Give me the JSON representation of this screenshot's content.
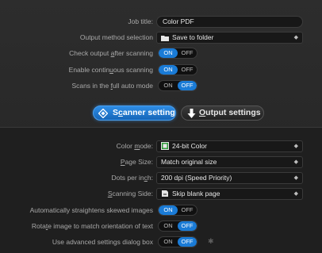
{
  "top": {
    "job_title": {
      "label": "Job title:",
      "value": "Color PDF"
    },
    "output_method": {
      "label": "Output method selection",
      "value": "Save to folder"
    },
    "check_output": {
      "label": "Check output after scanning",
      "on": "ON",
      "off": "OFF",
      "state": "on"
    },
    "continuous": {
      "label": "Enable continuous scanning",
      "on": "ON",
      "off": "OFF",
      "state": "on"
    },
    "full_auto": {
      "label": "Scans in the full auto mode",
      "on": "ON",
      "off": "OFF",
      "state": "off"
    }
  },
  "tabs": {
    "scanner": {
      "label": "Scanner setting",
      "active": true
    },
    "output": {
      "label": "Output settings",
      "active": false
    }
  },
  "scanner": {
    "color_mode": {
      "label": "Color mode:",
      "value": "24-bit Color"
    },
    "page_size": {
      "label": "Page Size:",
      "value": "Match original size"
    },
    "dpi": {
      "label": "Dots per inch:",
      "value": "200 dpi (Speed Priority)"
    },
    "scanning_side": {
      "label": "Scanning Side:",
      "value": "Skip blank page"
    },
    "straighten": {
      "label": "Automatically straightens skewed images",
      "on": "ON",
      "off": "OFF",
      "state": "on"
    },
    "rotate": {
      "label": "Rotate image to match orientation of text",
      "on": "ON",
      "off": "OFF",
      "state": "off"
    },
    "advanced": {
      "label": "Use advanced settings dialog box",
      "on": "ON",
      "off": "OFF",
      "state": "off"
    }
  },
  "colors": {
    "accent": "#1a7bd6",
    "background": "#262626"
  }
}
